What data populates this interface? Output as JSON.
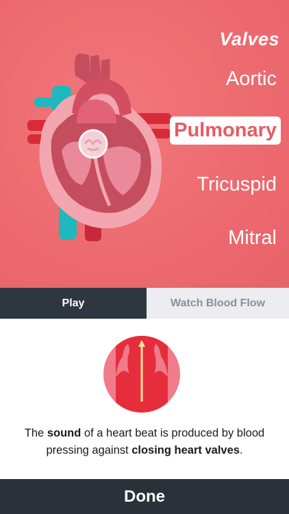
{
  "valves": {
    "title": "Valves",
    "items": [
      "Aortic",
      "Pulmonary",
      "Tricuspid",
      "Mitral"
    ],
    "selected": "Pulmonary"
  },
  "tabs": {
    "play": "Play",
    "watch_blood_flow": "Watch Blood Flow",
    "active": "Play"
  },
  "description": {
    "p1": "The ",
    "b1": "sound",
    "p2": " of a heart beat is produced by blood pressing against ",
    "b2": "closing heart valves",
    "p3": "."
  },
  "done_label": "Done",
  "colors": {
    "hero_background": "#ec6a6f",
    "selected_text": "#e85a62",
    "tab_active_bg": "#2e3640",
    "tab_inactive_bg": "#ececf1",
    "done_bg": "#2b3138"
  },
  "icons": {
    "hero": "heart-anatomy-illustration",
    "badge": "valve-flow-icon"
  }
}
